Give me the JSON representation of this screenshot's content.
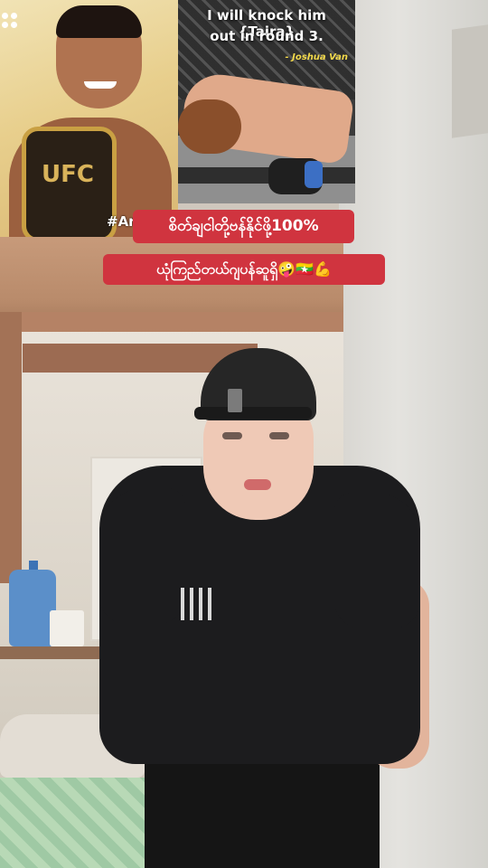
{
  "overlay": {
    "quote_line_1": "I will knock him {Taira}",
    "quote_line_2": "out in round 3.",
    "quote_attribution": "- Joshua Van",
    "belt_label": "UFC",
    "hashtag_partial": "#Ar",
    "caption_line_1": "စိတ်ချငါတို့ဗန်နိုင်ဖို့100%",
    "caption_line_2": "ယုံကြည်တယ်ဂျပန်ဆူရှိ🤪🇲🇲💪"
  },
  "colors": {
    "caption_bg": "#d0343f",
    "quote_attribution": "#f2d94b",
    "belt_gold": "#c9a043"
  },
  "icons": {
    "top_left_menu": "dots-menu-icon"
  }
}
